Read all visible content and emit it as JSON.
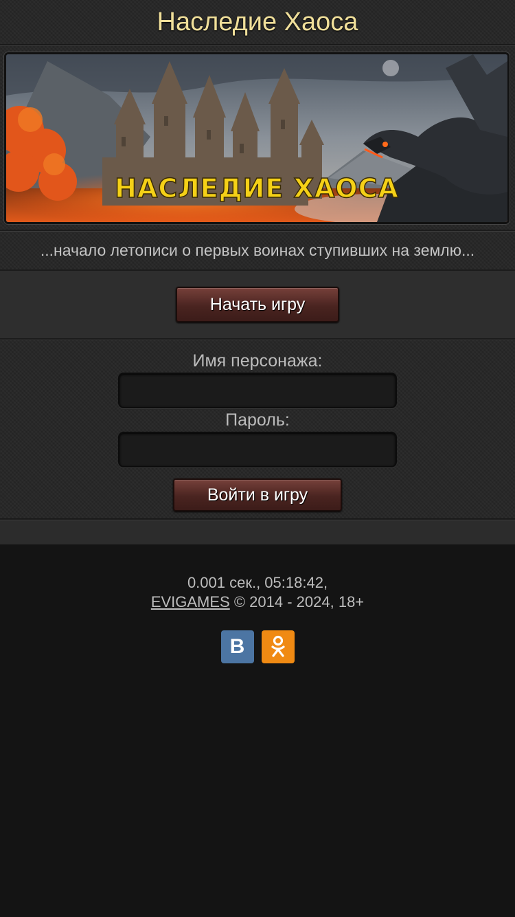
{
  "header": {
    "title": "Наследие Хаоса"
  },
  "banner": {
    "logo_text": "НАСЛЕДИЕ ХАОСА"
  },
  "tagline": "...начало летописи о первых воинах ступивших на землю...",
  "start_button": "Начать игру",
  "login": {
    "name_label": "Имя персонажа:",
    "name_value": "",
    "password_label": "Пароль:",
    "password_value": "",
    "submit_label": "Войти в игру"
  },
  "footer": {
    "timing": "0.001 сек., 05:18:42,",
    "brand_link": "EVIGAMES",
    "copyright": "© 2014 - 2024, 18+"
  },
  "socials": [
    {
      "name": "vk-icon",
      "glyph": "В",
      "color": "#4c75a3"
    },
    {
      "name": "ok-icon",
      "color": "#f08a13"
    }
  ],
  "colors": {
    "title": "#f0df9a",
    "button": "#4a2420",
    "banner_logo": "#f5d117"
  }
}
